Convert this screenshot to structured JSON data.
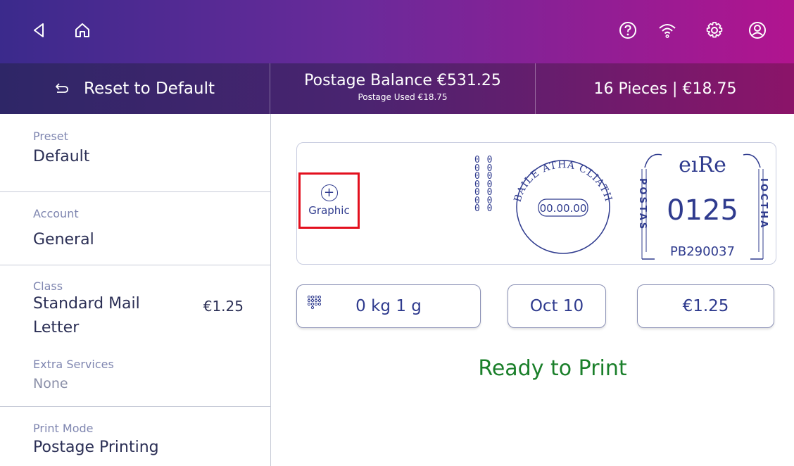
{
  "colors": {
    "accent": "#2f3b8e",
    "ready": "#1a7f2a",
    "highlight": "#e3101e"
  },
  "topbar": {
    "icons": [
      "back-icon",
      "home-icon",
      "help-icon",
      "wifi-icon",
      "settings-icon",
      "account-icon"
    ]
  },
  "toolbar": {
    "reset_label": "Reset to Default",
    "balance_label": "Postage Balance €531.25",
    "used_label": "Postage Used €18.75",
    "pieces_label": "16 Pieces | €18.75"
  },
  "left_panel": {
    "preset": {
      "label": "Preset",
      "value": "Default"
    },
    "account": {
      "label": "Account",
      "value": "General"
    },
    "class": {
      "label": "Class",
      "value_line1": "Standard Mail",
      "value_line2": "Letter",
      "price": "€1.25"
    },
    "extra": {
      "label": "Extra Services",
      "value": "None"
    },
    "print_mode": {
      "label": "Print Mode",
      "value": "Postage Printing"
    }
  },
  "stamp": {
    "graphic_label": "Graphic",
    "zeros": [
      "0 0",
      "0 0",
      "0 0",
      "0 0",
      "0 0",
      "0 0",
      "0 0"
    ],
    "postmark_text": "BAILE ATHA CLIATH",
    "postmark_date": "00.00.00",
    "country": "eıRe",
    "amount": "0125",
    "left_vertical": "POSTAS",
    "right_vertical": "IOCTHA",
    "meter_id": "PB290037"
  },
  "controls": {
    "weight": "0 kg 1 g",
    "date": "Oct 10",
    "amount": "€1.25"
  },
  "status": {
    "ready": "Ready to Print"
  }
}
